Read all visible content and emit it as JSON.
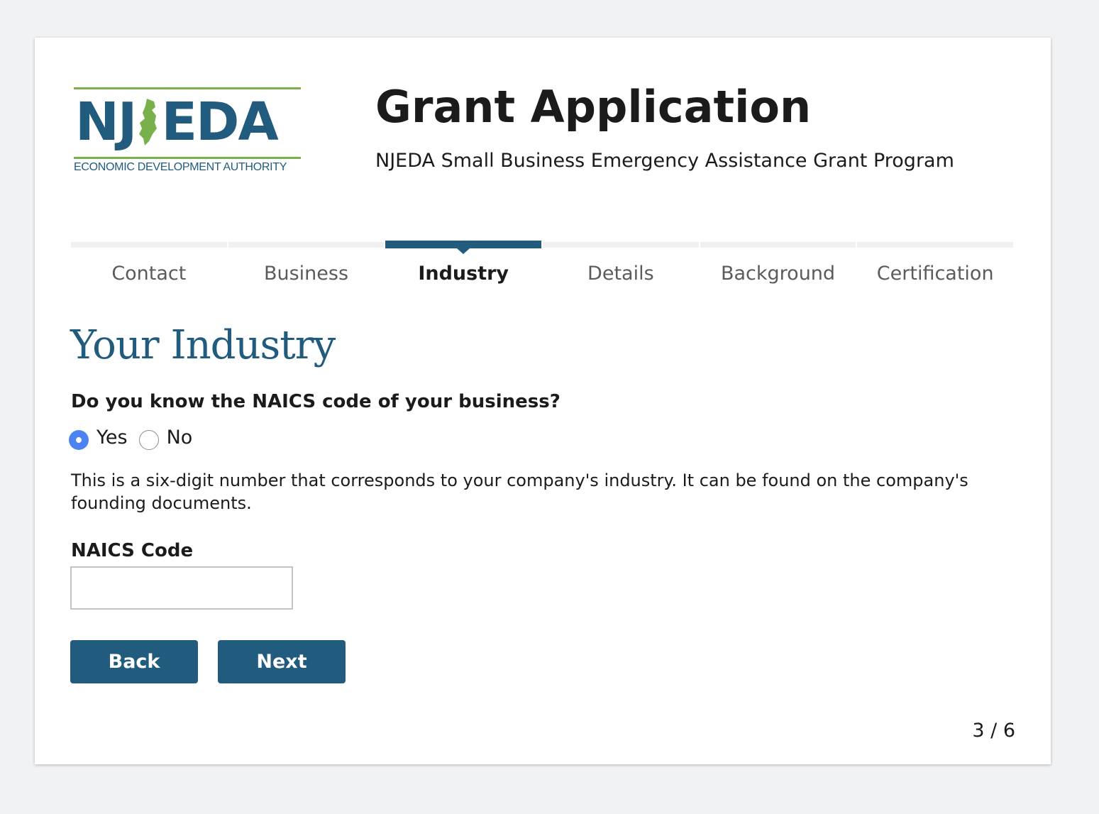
{
  "colors": {
    "brand_blue": "#215b7d",
    "logo_green": "#78b04b",
    "radio_checked": "#4c83f1",
    "stepper_inactive": "#f0f0f0",
    "page_background": "#f1f2f4"
  },
  "logo": {
    "letters_left": "NJ",
    "letters_right": "EDA",
    "tagline": "ECONOMIC DEVELOPMENT AUTHORITY",
    "icon": "new-jersey-state-icon",
    "letter_color": "#215b7d",
    "rule_color": "#78b04b"
  },
  "header": {
    "title": "Grant Application",
    "subtitle": "NJEDA Small Business Emergency Assistance Grant Program"
  },
  "stepper": {
    "steps": [
      {
        "label": "Contact",
        "active": false
      },
      {
        "label": "Business",
        "active": false
      },
      {
        "label": "Industry",
        "active": true
      },
      {
        "label": "Details",
        "active": false
      },
      {
        "label": "Background",
        "active": false
      },
      {
        "label": "Certification",
        "active": false
      }
    ]
  },
  "form": {
    "section_heading": "Your Industry",
    "question": "Do you know the NAICS code of your business?",
    "options": [
      {
        "label": "Yes",
        "selected": true
      },
      {
        "label": "No",
        "selected": false
      }
    ],
    "help_text": "This is a six-digit number that corresponds to your company's industry. It can be found on the company's founding documents.",
    "naics_label": "NAICS Code",
    "naics_value": "",
    "naics_placeholder": ""
  },
  "buttons": {
    "back_label": "Back",
    "next_label": "Next"
  },
  "pagination": {
    "counter": "3 / 6"
  }
}
